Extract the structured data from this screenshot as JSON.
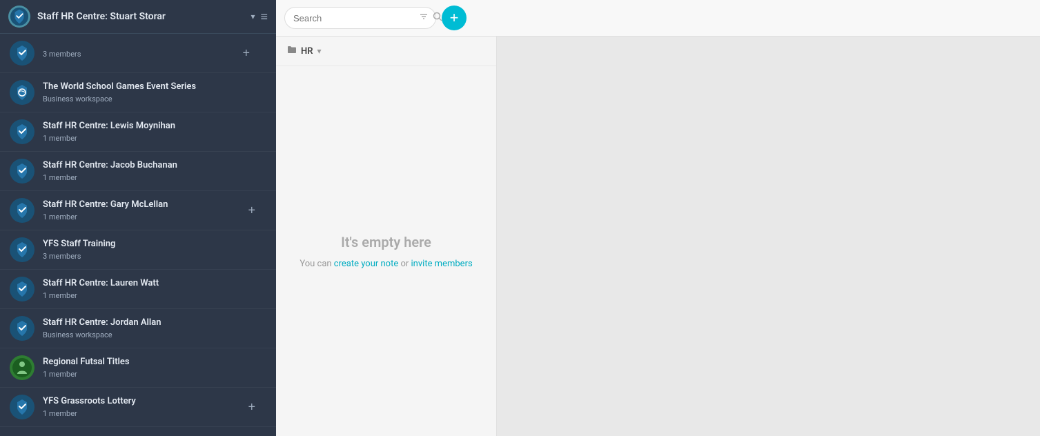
{
  "sidebar": {
    "header": {
      "title": "Staff HR Centre: Stuart Storar",
      "chevron": "▾",
      "menu_icon": "≡"
    },
    "workspaces": [
      {
        "id": "ws-0",
        "name": "",
        "sub": "3 members",
        "avatar_color": "#1a5276",
        "has_avatar": true
      },
      {
        "id": "ws-1",
        "name": "The World School Games Event Series",
        "sub": "Business workspace",
        "avatar_color": "#1a5276",
        "has_avatar": true
      },
      {
        "id": "ws-2",
        "name": "Staff HR Centre: Lewis Moynihan",
        "sub": "1 member",
        "avatar_color": "#1a5276",
        "has_avatar": true
      },
      {
        "id": "ws-3",
        "name": "Staff HR Centre: Jacob Buchanan",
        "sub": "1 member",
        "avatar_color": "#1a5276",
        "has_avatar": true
      },
      {
        "id": "ws-4",
        "name": "Staff HR Centre: Gary McLellan",
        "sub": "1 member",
        "avatar_color": "#1a5276",
        "has_avatar": true
      },
      {
        "id": "ws-5",
        "name": "YFS Staff Training",
        "sub": "3 members",
        "avatar_color": "#1a5276",
        "has_avatar": true
      },
      {
        "id": "ws-6",
        "name": "Staff HR Centre: Lauren Watt",
        "sub": "1 member",
        "avatar_color": "#1a5276",
        "has_avatar": true
      },
      {
        "id": "ws-7",
        "name": "Staff HR Centre: Jordan Allan",
        "sub": "Business workspace",
        "avatar_color": "#1a5276",
        "has_avatar": true
      },
      {
        "id": "ws-8",
        "name": "Regional Futsal Titles",
        "sub": "1 member",
        "avatar_color": "#2e7d32",
        "has_avatar": true
      },
      {
        "id": "ws-9",
        "name": "YFS Grassroots Lottery",
        "sub": "1 member",
        "avatar_color": "#1a5276",
        "has_avatar": true
      }
    ]
  },
  "topbar": {
    "search_placeholder": "Search",
    "add_button_label": "+",
    "filter_icon": "⚙",
    "search_icon_label": "🔍"
  },
  "folder": {
    "name": "HR",
    "icon": "📁",
    "chevron": "▾"
  },
  "empty_state": {
    "title": "It's empty here",
    "desc_prefix": "You can ",
    "create_link": "create your note",
    "desc_middle": " or ",
    "invite_link": "invite members"
  }
}
